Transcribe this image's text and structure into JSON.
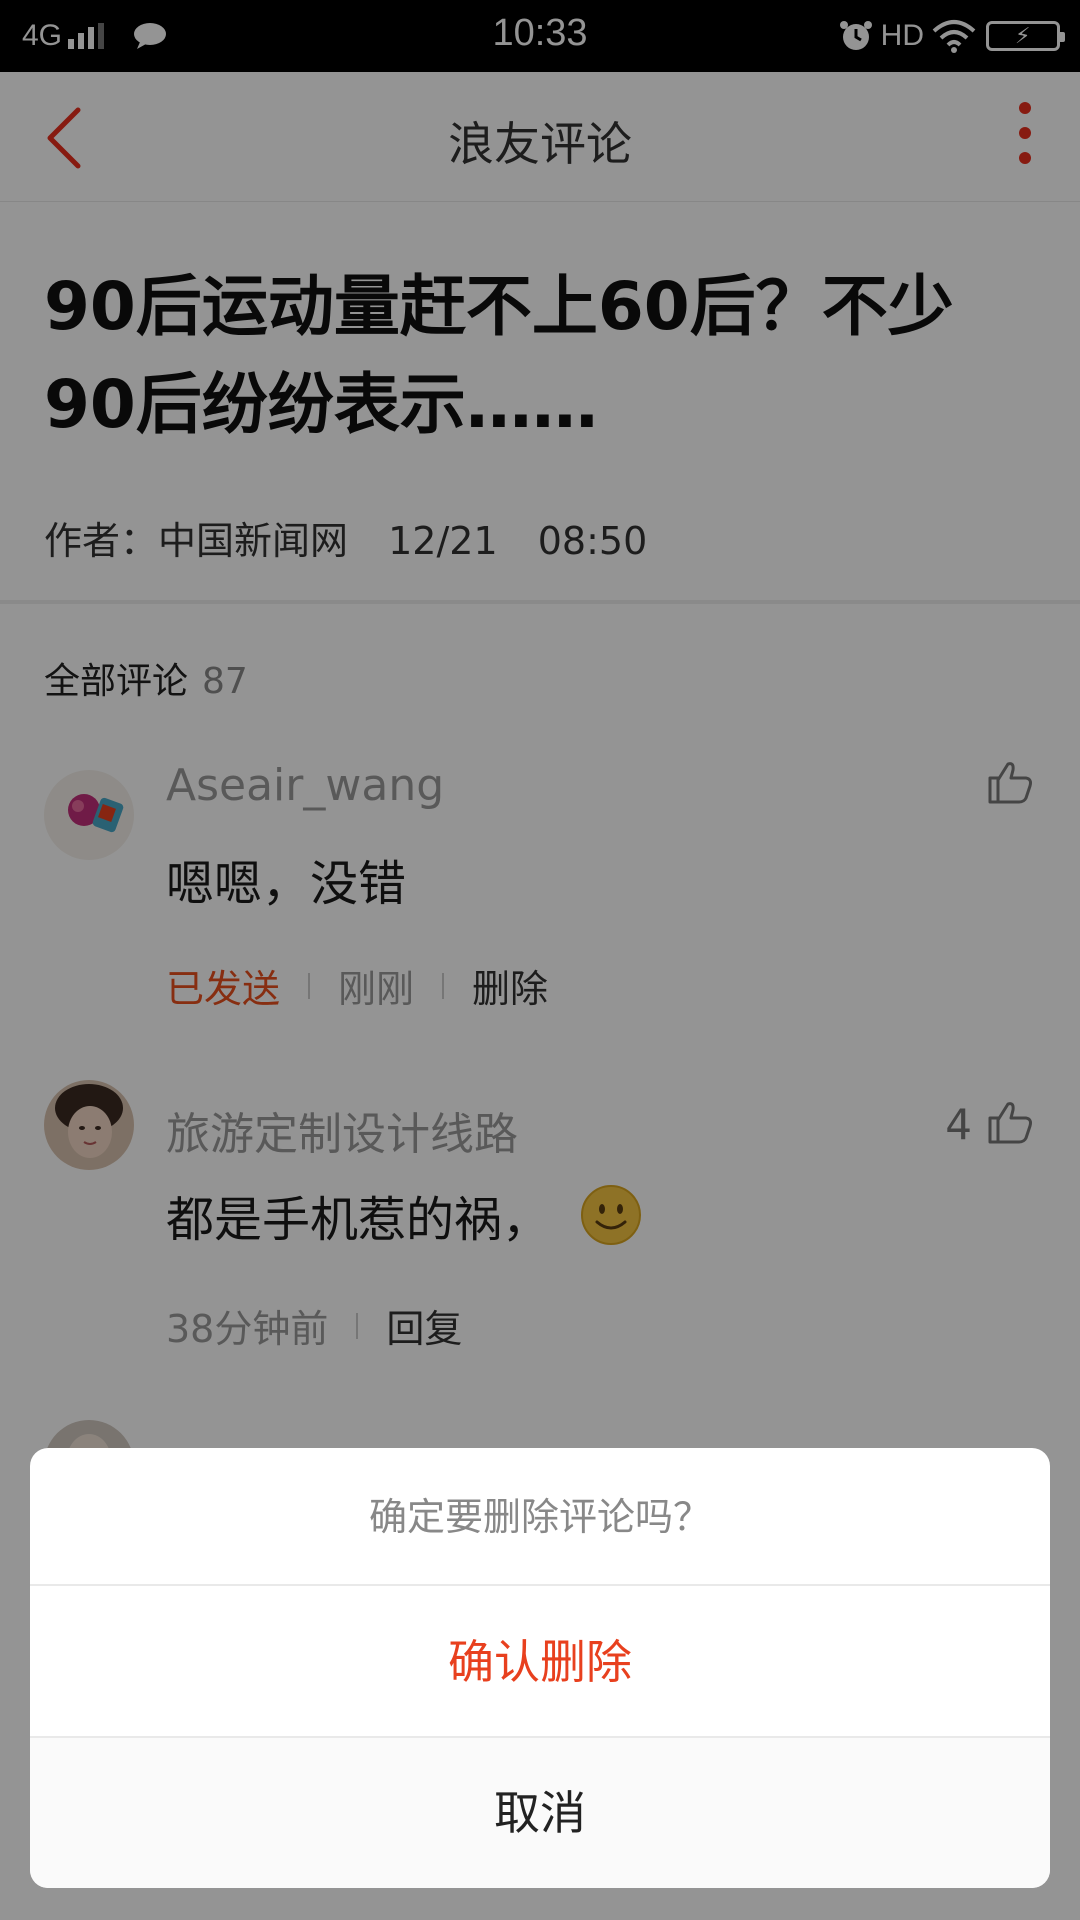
{
  "status_bar": {
    "network": "4G",
    "time": "10:33",
    "hd": "HD"
  },
  "nav": {
    "title": "浪友评论"
  },
  "article": {
    "title": "90后运动量赶不上60后？不少90后纷纷表示……",
    "author_label": "作者：",
    "author": "中国新闻网",
    "date": "12/21",
    "time": "08:50"
  },
  "comments": {
    "heading": "全部评论",
    "count": "87",
    "items": [
      {
        "user": "Aseair_wang",
        "text": "嗯嗯，没错",
        "status": "已发送",
        "time": "刚刚",
        "action": "删除",
        "likes": ""
      },
      {
        "user": "旅游定制设计线路",
        "text": "都是手机惹的祸，",
        "emoji": "smile-emoji",
        "time": "38分钟前",
        "action": "回复",
        "likes": "4"
      }
    ]
  },
  "dialog": {
    "question": "确定要删除评论吗？",
    "confirm": "确认删除",
    "cancel": "取消"
  },
  "colors": {
    "accent": "#e8301e",
    "sent": "#e8501e",
    "overlay": "rgba(0,0,0,0.42)"
  }
}
